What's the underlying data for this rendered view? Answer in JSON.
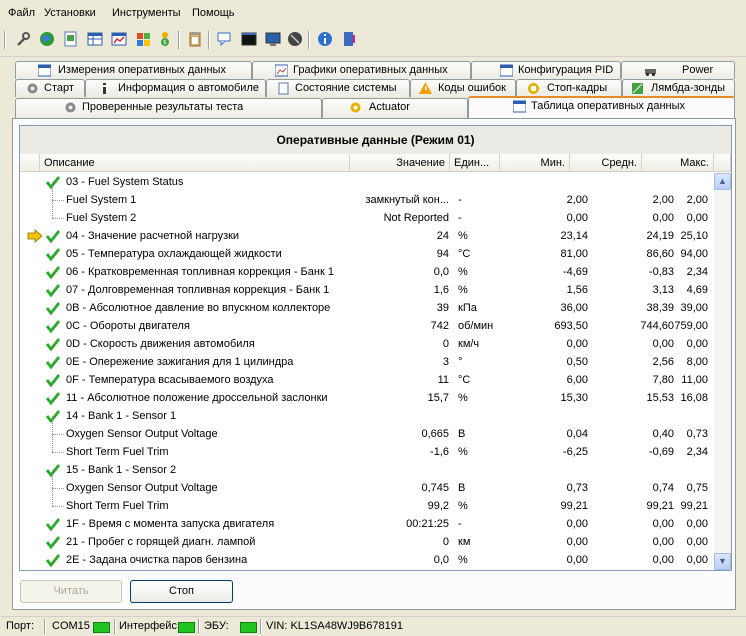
{
  "menu": [
    "Файл",
    "Установки",
    "Инструменты",
    "Помощь"
  ],
  "toolbar_icons": [
    "wrench-icon",
    "globe-icon",
    "document-icon",
    "table-icon",
    "chart-icon",
    "windows-icon",
    "money-icon",
    "clipboard-icon",
    "chat-icon",
    "terminal-icon",
    "monitor-icon",
    "disc-icon",
    "info-icon",
    "book-icon"
  ],
  "tabs_row1": [
    "Измерения оперативных данных",
    "Графики оперативных данных",
    "Конфигурация PID",
    "Power"
  ],
  "tabs_row2": [
    "Старт",
    "Информация о автомобиле",
    "Состояние системы",
    "Коды ошибок",
    "Стоп-кадры",
    "Лямбда-зонды"
  ],
  "tabs_row3": [
    "Проверенные результаты теста",
    "Actuator",
    "Таблица оперативных данных"
  ],
  "grid": {
    "title": "Оперативные данные (Режим 01)",
    "headers": {
      "desc": "Описание",
      "value": "Значение",
      "unit": "Един...",
      "min": "Мин.",
      "avg": "Средн.",
      "max": "Макс."
    },
    "rows": [
      {
        "mark": "check",
        "desc": "03 - Fuel System Status",
        "value": "",
        "unit": "",
        "min": "",
        "avg": "",
        "max": ""
      },
      {
        "mark": "child",
        "desc": "Fuel System 1",
        "value": "замкнутый кон...",
        "unit": "-",
        "min": "2,00",
        "avg": "2,00",
        "max": "2,00"
      },
      {
        "mark": "child",
        "desc": "Fuel System 2",
        "value": "Not Reported",
        "unit": "-",
        "min": "0,00",
        "avg": "0,00",
        "max": "0,00"
      },
      {
        "mark": "arrow",
        "desc": "04 - Значение расчетной нагрузки",
        "value": "24",
        "unit": "%",
        "min": "23,14",
        "avg": "24,19",
        "max": "25,10"
      },
      {
        "mark": "check",
        "desc": "05 - Температура охлаждающей жидкости",
        "value": "94",
        "unit": "°C",
        "min": "81,00",
        "avg": "86,60",
        "max": "94,00"
      },
      {
        "mark": "check",
        "desc": "06 - Кратковременная топливная коррекция - Банк 1",
        "value": "0,0",
        "unit": "%",
        "min": "-4,69",
        "avg": "-0,83",
        "max": "2,34"
      },
      {
        "mark": "check",
        "desc": "07 - Долговременная топливная коррекция - Банк 1",
        "value": "1,6",
        "unit": "%",
        "min": "1,56",
        "avg": "3,13",
        "max": "4,69"
      },
      {
        "mark": "check",
        "desc": "0B - Абсолютное давление во впускном коллекторе",
        "value": "39",
        "unit": "кПа",
        "min": "36,00",
        "avg": "38,39",
        "max": "39,00"
      },
      {
        "mark": "check",
        "desc": "0C - Обороты двигателя",
        "value": "742",
        "unit": "об/мин",
        "min": "693,50",
        "avg": "744,60",
        "max": "759,00"
      },
      {
        "mark": "check",
        "desc": "0D - Скорость движения автомобиля",
        "value": "0",
        "unit": "км/ч",
        "min": "0,00",
        "avg": "0,00",
        "max": "0,00"
      },
      {
        "mark": "check",
        "desc": "0E - Опережение зажигания для 1 цилиндра",
        "value": "3",
        "unit": "°",
        "min": "0,50",
        "avg": "2,56",
        "max": "8,00"
      },
      {
        "mark": "check",
        "desc": "0F - Температура  всасываемого воздуха",
        "value": "11",
        "unit": "°C",
        "min": "6,00",
        "avg": "7,80",
        "max": "11,00"
      },
      {
        "mark": "check",
        "desc": "11 - Абсолютное положение дроссельной заслонки",
        "value": "15,7",
        "unit": "%",
        "min": "15,30",
        "avg": "15,53",
        "max": "16,08"
      },
      {
        "mark": "check",
        "desc": "14 - Bank 1 - Sensor 1",
        "value": "",
        "unit": "",
        "min": "",
        "avg": "",
        "max": ""
      },
      {
        "mark": "child",
        "desc": "Oxygen Sensor Output Voltage",
        "value": "0,665",
        "unit": "В",
        "min": "0,04",
        "avg": "0,40",
        "max": "0,73"
      },
      {
        "mark": "child",
        "desc": "Short Term Fuel Trim",
        "value": "-1,6",
        "unit": "%",
        "min": "-6,25",
        "avg": "-0,69",
        "max": "2,34"
      },
      {
        "mark": "check",
        "desc": "15 - Bank 1 - Sensor 2",
        "value": "",
        "unit": "",
        "min": "",
        "avg": "",
        "max": ""
      },
      {
        "mark": "child",
        "desc": "Oxygen Sensor Output Voltage",
        "value": "0,745",
        "unit": "В",
        "min": "0,73",
        "avg": "0,74",
        "max": "0,75"
      },
      {
        "mark": "child",
        "desc": "Short Term Fuel Trim",
        "value": "99,2",
        "unit": "%",
        "min": "99,21",
        "avg": "99,21",
        "max": "99,21"
      },
      {
        "mark": "check",
        "desc": "1F - Время с момента запуска двигателя",
        "value": "00:21:25",
        "unit": "-",
        "min": "0,00",
        "avg": "0,00",
        "max": "0,00"
      },
      {
        "mark": "check",
        "desc": "21 - Пробег с горящей диагн. лампой",
        "value": "0",
        "unit": "км",
        "min": "0,00",
        "avg": "0,00",
        "max": "0,00"
      },
      {
        "mark": "check",
        "desc": "2E - Задана очистка паров бензина",
        "value": "0,0",
        "unit": "%",
        "min": "0,00",
        "avg": "0,00",
        "max": "0,00"
      }
    ]
  },
  "buttons": {
    "read": "Читать",
    "stop": "Стоп"
  },
  "status": {
    "port_label": "Порт:",
    "port": "COM15",
    "iface": "Интерфейс:",
    "ecu": "ЭБУ:",
    "vin": "VIN: KL1SA48WJ9B678191"
  },
  "colors": {
    "check": "#2eaa2e",
    "arrow": "#f5c400",
    "led": "#21c521"
  }
}
